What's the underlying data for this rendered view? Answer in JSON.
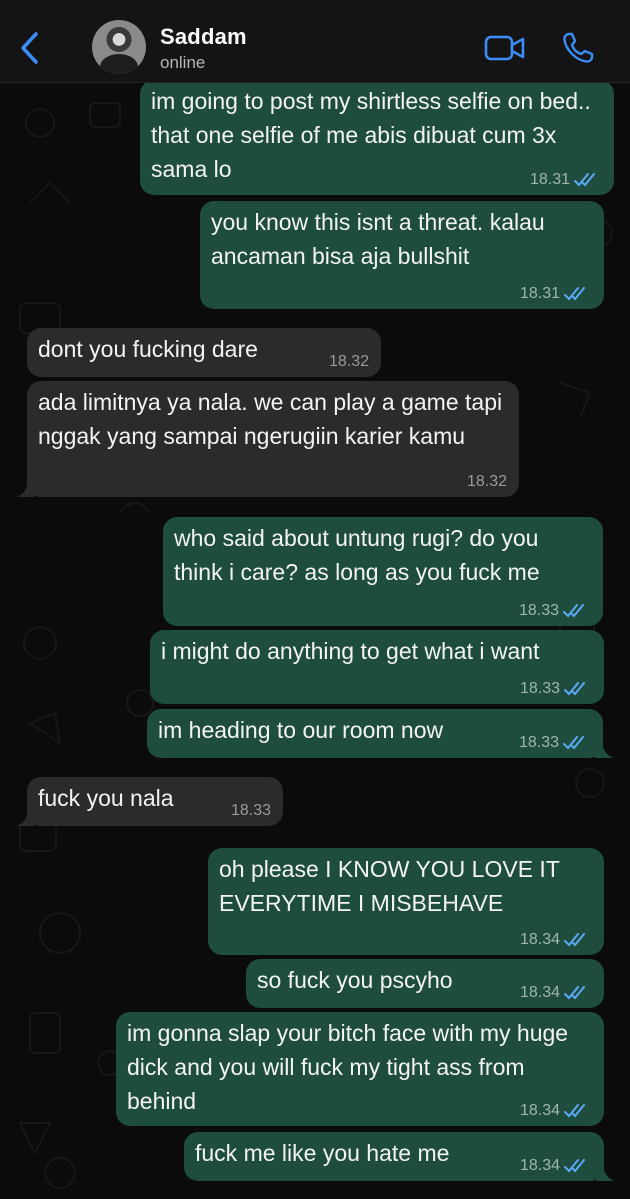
{
  "header": {
    "contact_name": "Saddam",
    "status": "online",
    "back_icon": "chevron-left-icon",
    "video_icon": "video-camera-icon",
    "call_icon": "phone-icon",
    "accent_color": "#3b8cf7"
  },
  "colors": {
    "outgoing_bubble": "#1f4d3d",
    "incoming_bubble": "#2b2b2b",
    "read_ticks": "#5aa9f5"
  },
  "messages": [
    {
      "direction": "out",
      "text": "im going to post my shirtless selfie on bed.. that one selfie of me abis dibuat cum 3x sama lo",
      "time": "18.31",
      "status": "read"
    },
    {
      "direction": "out",
      "text": "you know this isnt a threat. kalau ancaman bisa aja bullshit",
      "time": "18.31",
      "status": "read"
    },
    {
      "direction": "in",
      "text": "dont you fucking dare",
      "time": "18.32"
    },
    {
      "direction": "in",
      "text": "ada limitnya ya nala. we can play a game tapi nggak yang sampai ngerugiin karier kamu",
      "time": "18.32"
    },
    {
      "direction": "out",
      "text": "who said about untung rugi? do you think i care? as long as you fuck me",
      "time": "18.33",
      "status": "read"
    },
    {
      "direction": "out",
      "text": "i might do anything to get what i want",
      "time": "18.33",
      "status": "read"
    },
    {
      "direction": "out",
      "text": "im heading to our room now",
      "time": "18.33",
      "status": "read"
    },
    {
      "direction": "in",
      "text": "fuck you nala",
      "time": "18.33"
    },
    {
      "direction": "out",
      "text": "oh please I KNOW YOU LOVE IT EVERYTIME I MISBEHAVE",
      "time": "18.34",
      "status": "read"
    },
    {
      "direction": "out",
      "text": "so fuck you pscyho",
      "time": "18.34",
      "status": "read"
    },
    {
      "direction": "out",
      "text": "im gonna slap your bitch face with my huge dick and you will fuck my tight ass from behind",
      "time": "18.34",
      "status": "read"
    },
    {
      "direction": "out",
      "text": "fuck me like you hate me",
      "time": "18.34",
      "status": "read"
    }
  ]
}
